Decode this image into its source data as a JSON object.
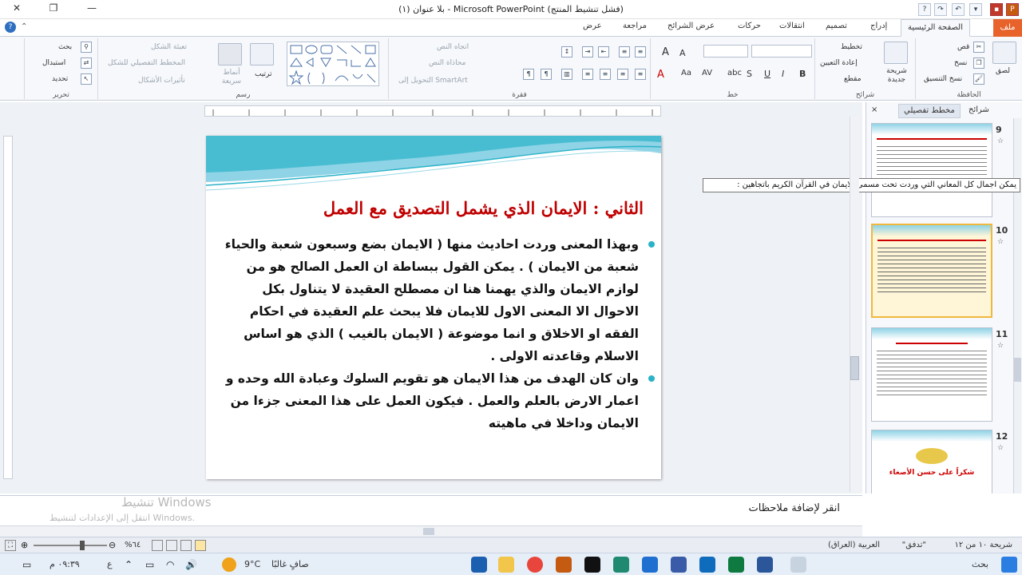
{
  "window": {
    "title": "بلا عنوان (١) - Microsoft PowerPoint (فشل تنشيط المنتج)"
  },
  "ribbon_tabs": {
    "file": "ملف",
    "home": "الصفحة الرئيسية",
    "insert": "إدراج",
    "design": "تصميم",
    "transitions": "انتقالات",
    "animations": "حركات",
    "slideshow": "عرض الشرائح",
    "review": "مراجعة",
    "view": "عرض"
  },
  "ribbon": {
    "clipboard": {
      "label": "الحافظة",
      "paste": "لصق",
      "cut": "قص",
      "copy": "نسخ",
      "format_painter": "نسخ التنسيق"
    },
    "slides": {
      "label": "شرائح",
      "new_slide": "شريحة جديدة",
      "layout": "تخطيط",
      "reset": "إعادة التعيين",
      "section": "مقطع"
    },
    "font": {
      "label": "خط"
    },
    "paragraph": {
      "label": "فقرة",
      "text_direction": "اتجاه النص",
      "align_text": "محاذاة النص",
      "smartart": "التحويل إلى SmartArt"
    },
    "drawing": {
      "label": "رسم",
      "arrange": "ترتيب",
      "quick_styles": "أنماط سريعة",
      "shape_fill": "تعبئة الشكل",
      "shape_outline": "المخطط التفصيلي للشكل",
      "shape_effects": "تأثيرات الأشكال"
    },
    "editing": {
      "label": "تحرير",
      "find": "بحث",
      "replace": "استبدال",
      "select": "تحديد"
    }
  },
  "panel": {
    "tab_slides": "شرائح",
    "tab_outline": "مخطط تفصيلي",
    "close": "×",
    "thumbnails": [
      {
        "num": "9"
      },
      {
        "num": "10"
      },
      {
        "num": "11"
      },
      {
        "num": "12",
        "caption": "شكراً على حسن الأصغاء"
      }
    ]
  },
  "tooltip": "يمكن اجمال كل المعاني التي وردت تحت مسمى الايمان في القرآن الكريم باتجاهين :",
  "slide": {
    "title": "الثاني : الايمان الذي يشمل التصديق مع العمل",
    "bullets": [
      "وبهذا المعنى وردت احاديث منها ( الايمان بضع وسبعون شعبة والحياء شعبة من الايمان ) . يمكن القول ببساطة ان العمل الصالح هو من لوازم الايمان والذي يهمنا هنا ان مصطلح العقيدة لا يتناول بكل الاحوال الا المعنى الاول للايمان فلا يبحث علم العقيدة في احكام الفقه او الاخلاق و انما موضوعة ( الايمان بالغيب ) الذي هو اساس الاسلام وقاعدته الاولى .",
      "وان كان الهدف من هذا الايمان هو تقويم السلوك وعبادة الله وحده و اعمار الارض بالعلم والعمل . فيكون العمل على هذا المعنى جزءا من الايمان وداخلا في ماهيته"
    ]
  },
  "notes": {
    "placeholder": "انقر لإضافة ملاحظات"
  },
  "watermark": {
    "line1": "تنشيط Windows",
    "line2": "انتقل إلى الإعدادات لتنشيط Windows."
  },
  "statusbar": {
    "slide_info": "شريحة ١٠ من ١٢",
    "theme": "\"تدفق\"",
    "language": "العربية (العراق)",
    "zoom": "%٦٤"
  },
  "taskbar": {
    "search": "بحث",
    "weather_temp": "9°C",
    "weather_desc": "صافٍ غالبًا",
    "time": "٠٩:٣٩ م",
    "lang": "ع"
  },
  "colors": {
    "accent_file": "#e8632c",
    "title_red": "#c00000",
    "bullet_teal": "#2ab3c8",
    "selected_thumb": "#f0b83c"
  }
}
